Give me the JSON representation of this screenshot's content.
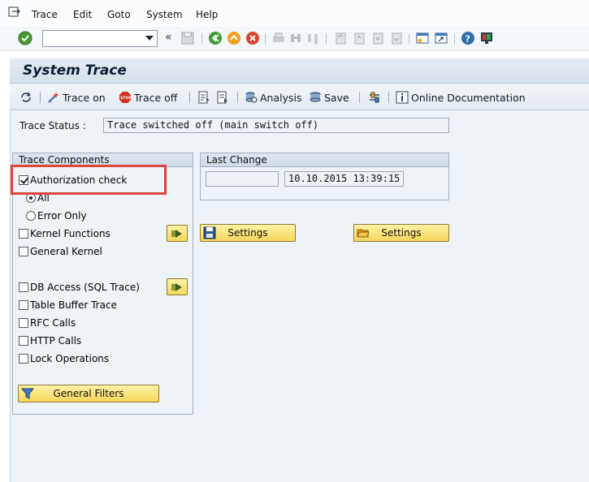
{
  "menu": {
    "items": [
      "Trace",
      "Edit",
      "Goto",
      "System",
      "Help"
    ]
  },
  "title": "System Trace",
  "app_toolbar": {
    "trace_on": "Trace on",
    "trace_off": "Trace off",
    "analysis": "Analysis",
    "save": "Save",
    "online_doc": "Online Documentation"
  },
  "trace_status": {
    "label": "Trace Status :",
    "value": "Trace switched off (main switch off)"
  },
  "trace_components": {
    "title": "Trace Components",
    "authorization_check": "Authorization check",
    "radio_all": "All",
    "radio_error_only": "Error Only",
    "kernel_functions": "Kernel Functions",
    "general_kernel": "General Kernel",
    "db_access": "DB Access (SQL Trace)",
    "table_buffer": "Table Buffer Trace",
    "rfc_calls": "RFC Calls",
    "http_calls": "HTTP Calls",
    "lock_operations": "Lock Operations",
    "general_filters": "General Filters"
  },
  "last_change": {
    "title": "Last Change",
    "user": "",
    "datetime": "10.10.2015 13:39:15"
  },
  "settings_label": "Settings",
  "colors": {
    "highlight": "#e0453c",
    "button_yellow": "#f5d65c"
  }
}
